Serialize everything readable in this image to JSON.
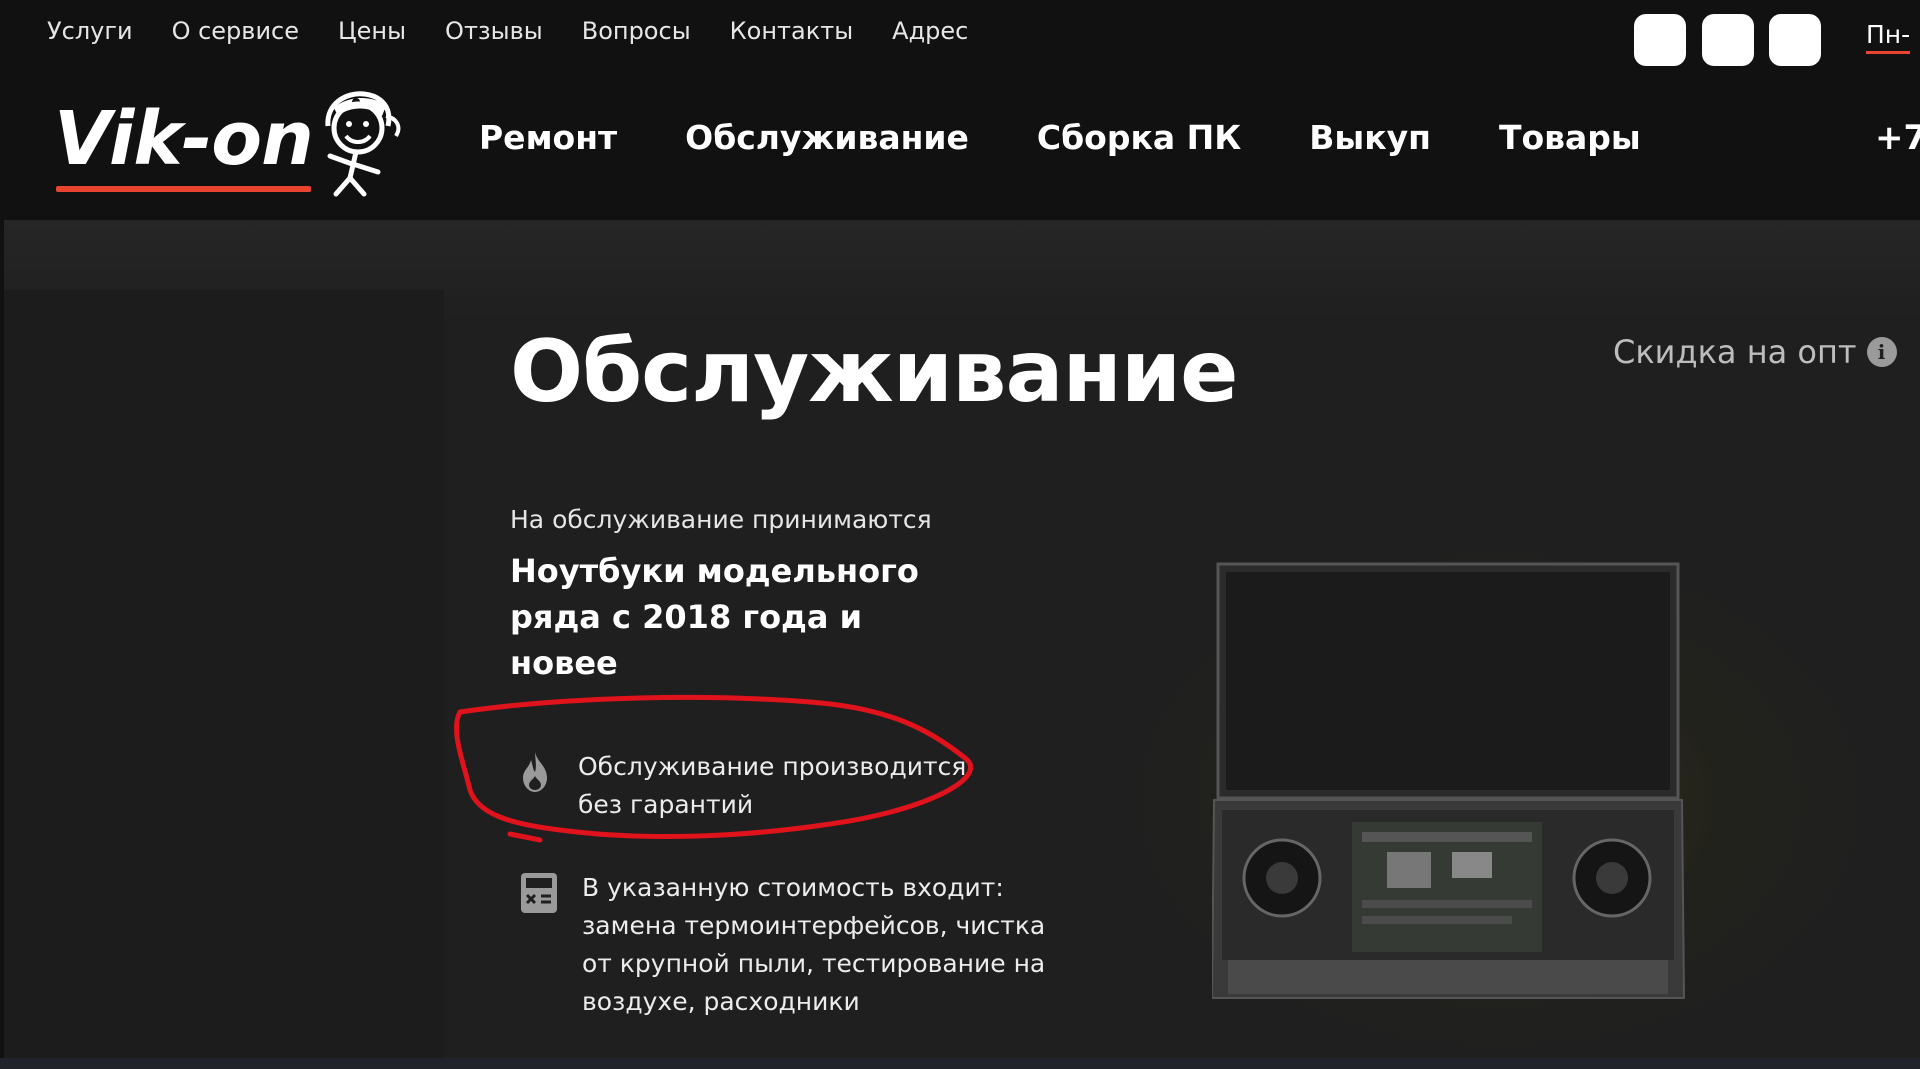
{
  "top_nav": [
    "Услуги",
    "О сервисе",
    "Цены",
    "Отзывы",
    "Вопросы",
    "Контакты",
    "Адрес"
  ],
  "header": {
    "logo_text": "Vik-on",
    "hours_fragment": "Пн-",
    "phone_fragment": "+7",
    "brand_color": "#e8442f"
  },
  "main_nav": [
    "Ремонт",
    "Обслуживание",
    "Сборка ПК",
    "Выкуп",
    "Товары"
  ],
  "hero": {
    "title": "Обслуживание",
    "discount_label": "Скидка на опт",
    "subtitle": "На обслуживание принимаются",
    "models_text": "Ноутбуки модельного ряда с 2018 года и новее",
    "feature_no_warranty": "Обслуживание производится без гарантий",
    "feature_included": "В указанную стоимость входит: замена термоинтерфейсов, чистка от крупной пыли, тестирование на воздухе, расходники",
    "annotation_color": "#e0121b"
  }
}
